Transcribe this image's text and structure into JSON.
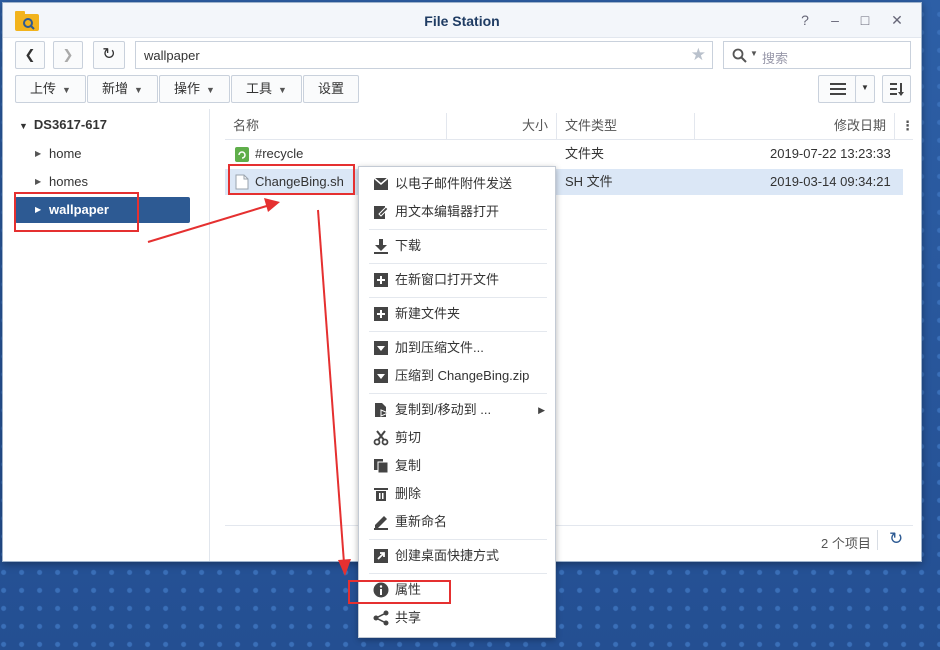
{
  "window": {
    "title": "File Station"
  },
  "nav": {
    "path": "wallpaper",
    "search_placeholder": "搜索"
  },
  "toolbar": {
    "upload": "上传",
    "create": "新增",
    "action": "操作",
    "tools": "工具",
    "settings": "设置"
  },
  "tree": {
    "root": "DS3617-617",
    "items": [
      {
        "label": "home"
      },
      {
        "label": "homes"
      },
      {
        "label": "wallpaper"
      }
    ]
  },
  "table": {
    "headers": {
      "name": "名称",
      "size": "大小",
      "type": "文件类型",
      "modified": "修改日期"
    },
    "rows": [
      {
        "name": "#recycle",
        "size": "",
        "type": "文件夹",
        "modified": "2019-07-22 13:23:33"
      },
      {
        "name": "ChangeBing.sh",
        "size": "",
        "type": "SH 文件",
        "modified": "2019-03-14 09:34:21"
      }
    ]
  },
  "status": {
    "count": "2 个项目"
  },
  "context_menu": {
    "items": [
      {
        "label": "以电子邮件附件发送",
        "icon": "mail-icon"
      },
      {
        "label": "用文本编辑器打开",
        "icon": "edit-icon"
      },
      {
        "label": "下载",
        "icon": "download-icon"
      },
      {
        "label": "在新窗口打开文件",
        "icon": "new-window-icon"
      },
      {
        "label": "新建文件夹",
        "icon": "new-folder-icon"
      },
      {
        "label": "加到压缩文件...",
        "icon": "archive-icon"
      },
      {
        "label": "压缩到 ChangeBing.zip",
        "icon": "archive-icon"
      },
      {
        "label": "复制到/移动到 ...",
        "icon": "copy-move-icon"
      },
      {
        "label": "剪切",
        "icon": "scissors-icon"
      },
      {
        "label": "复制",
        "icon": "copy-icon"
      },
      {
        "label": "删除",
        "icon": "trash-icon"
      },
      {
        "label": "重新命名",
        "icon": "rename-icon"
      },
      {
        "label": "创建桌面快捷方式",
        "icon": "shortcut-icon"
      },
      {
        "label": "属性",
        "icon": "info-icon"
      },
      {
        "label": "共享",
        "icon": "share-icon"
      }
    ]
  },
  "colors": {
    "accent": "#2d5a93",
    "highlight": "#e53030",
    "selected_row": "#dbe7f6"
  }
}
